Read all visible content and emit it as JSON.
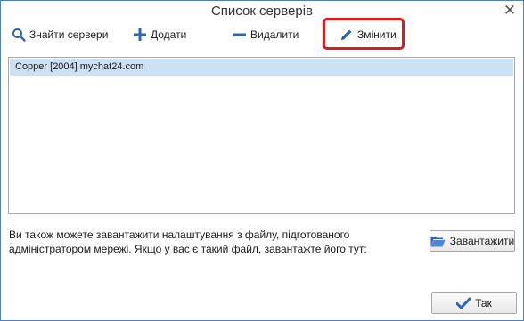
{
  "window": {
    "title": "Список серверів",
    "close_glyph": "✕"
  },
  "toolbar": {
    "find_label": "Знайти сервери",
    "add_label": "Додати",
    "delete_label": "Видалити",
    "edit_label": "Змінити"
  },
  "servers": [
    {
      "label": "Copper [2004] mychat24.com"
    }
  ],
  "info": {
    "text": "Ви також можете завантажити налаштування з файлу, підготованого адміністратором мережі. Якщо у вас є такий файл, завантажте його тут:"
  },
  "buttons": {
    "load_label": "Завантажити",
    "ok_label": "Так"
  },
  "colors": {
    "highlight": "#e0161f",
    "selection": "#cde1f5",
    "icon_blue": "#2e67b1"
  }
}
